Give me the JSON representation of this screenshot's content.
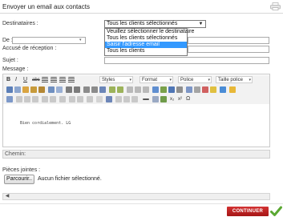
{
  "header": {
    "title": "Envoyer un email aux contacts"
  },
  "form": {
    "recipients_label": "Destinataires :",
    "recipients_selected": "Tous les clients sélectionnés",
    "recipients_options": [
      "Veuillez sélectionner le destinataire",
      "Tous les clients sélectionnés",
      "Saisir l'adresse email",
      "Tous les clients"
    ],
    "recipients_highlighted_index": 2,
    "from_label": "De :",
    "receipt_label": "Accusé de réception :",
    "subject_label": "Sujet :",
    "message_label": "Message :"
  },
  "editor": {
    "style_dropdown": "Styles",
    "format_dropdown": "Format",
    "font_dropdown": "Police",
    "size_dropdown": "Taille police",
    "body_text": "Bien cordialement. LG"
  },
  "path_label": "Chemin:",
  "attachments": {
    "label": "Pièces jointes :",
    "browse_button": "Parcourir..",
    "no_file_text": "Aucun fichier sélectionné."
  },
  "footer": {
    "continue_button": "CONTINUER"
  },
  "colors": {
    "accent_red": "#c02020",
    "highlight_blue": "#3399ff",
    "confirm_green": "#5aa832"
  }
}
